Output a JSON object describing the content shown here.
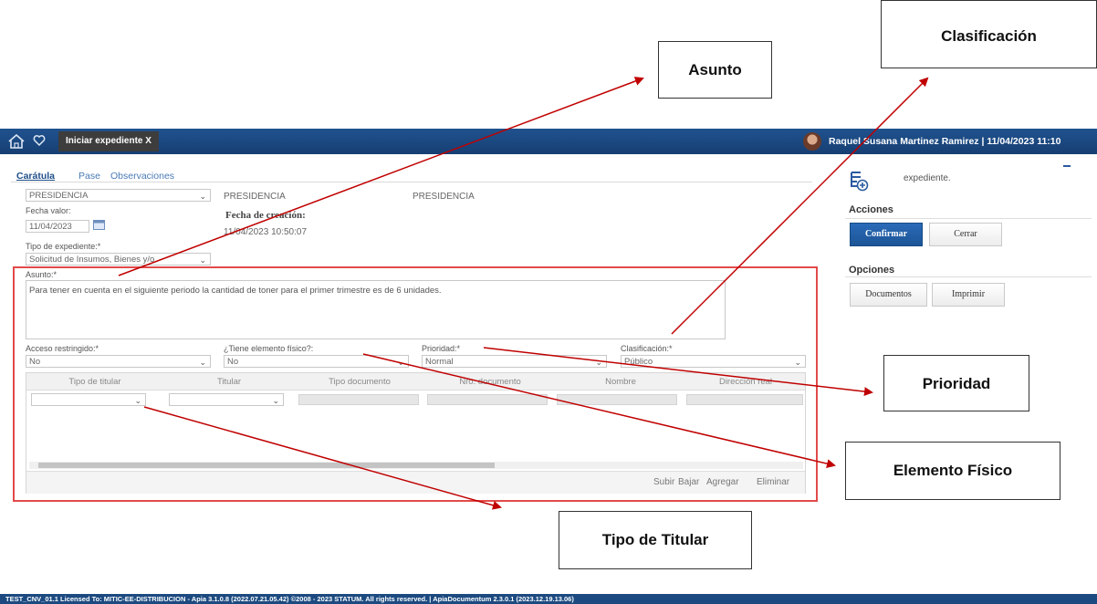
{
  "topbar": {
    "tab_label": "Iniciar expediente X",
    "user_label": "Raquel Susana Martinez Ramirez | 11/04/2023 11:10"
  },
  "tabs": [
    "Carátula",
    "Pase",
    "Observaciones"
  ],
  "form": {
    "reparticion_value": "PRESIDENCIA",
    "dependencia_value": "PRESIDENCIA",
    "area_value": "PRESIDENCIA",
    "fecha_valor_label": "Fecha valor:",
    "fecha_valor_value": "11/04/2023",
    "fecha_creacion_label": "Fecha de creación:",
    "fecha_creacion_value": "11/04/2023 10:50:07",
    "tipo_expediente_label": "Tipo de expediente:*",
    "tipo_expediente_value": "Solicitud de Insumos, Bienes y/o",
    "asunto_label": "Asunto:*",
    "asunto_value": "Para tener en cuenta en el siguiente periodo la cantidad de toner para el primer trimestre es de 6 unidades.",
    "acceso_label": "Acceso restringido:*",
    "acceso_value": "No",
    "elemento_label": "¿Tiene elemento físico?:",
    "elemento_value": "No",
    "prioridad_label": "Prioridad:*",
    "prioridad_value": "Normal",
    "clasificacion_label": "Clasificación:*",
    "clasificacion_value": "Público"
  },
  "table": {
    "headers": [
      "Tipo de titular",
      "Titular",
      "Tipo documento",
      "Nro. documento",
      "Nombre",
      "Dirección real"
    ],
    "actions": [
      "Subir",
      "Bajar",
      "Agregar",
      "Eliminar"
    ]
  },
  "sidebar": {
    "expediente_text": "expediente.",
    "acciones_title": "Acciones",
    "confirmar_label": "Confirmar",
    "cerrar_label": "Cerrar",
    "opciones_title": "Opciones",
    "documentos_label": "Documentos",
    "imprimir_label": "Imprimir"
  },
  "callouts": {
    "asunto": "Asunto",
    "clasificacion": "Clasificación",
    "prioridad": "Prioridad",
    "elemento_fisico": "Elemento Físico",
    "tipo_titular": "Tipo de Titular"
  },
  "footer_text": "TEST_CNV_01.1 Licensed To: MITIC-EE-DISTRIBUCION - Apia 3.1.0.8 (2022.07.21.05.42)     ©2008 - 2023 STATUM. All rights reserved. | ApiaDocumentum 2.3.0.1 (2023.12.19.13.06)",
  "colors": {
    "topbar": "#1a4a85",
    "confirm": "#1f5fa5",
    "highlight_box": "#e23b3b",
    "arrow": "#c00000"
  }
}
